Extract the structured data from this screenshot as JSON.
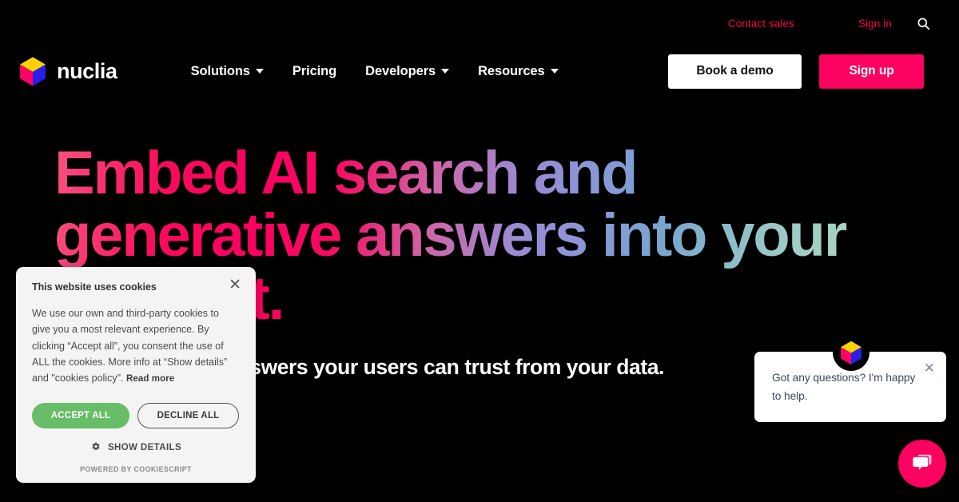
{
  "brand": {
    "name": "nuclia",
    "logo_icon": "nuclia-cube-logo",
    "accent_pink": "#fb0160",
    "cube_top": "#ffd300",
    "cube_left": "#ff0066",
    "cube_right": "#2b1ee8"
  },
  "utility": {
    "contact_sales": "Contact sales",
    "sign_in": "Sign in",
    "search_icon": "search-icon"
  },
  "nav": {
    "items": [
      {
        "label": "Solutions",
        "has_caret": true
      },
      {
        "label": "Pricing",
        "has_caret": false
      },
      {
        "label": "Developers",
        "has_caret": true
      },
      {
        "label": "Resources",
        "has_caret": true
      }
    ],
    "book_demo": "Book a demo",
    "sign_up": "Sign up"
  },
  "hero": {
    "title": "Embed AI search and generative answers into your product.",
    "subtitle": "Use Nuclia to get answers your users can trust from your data."
  },
  "cookie_banner": {
    "title": "This website uses cookies",
    "body": "We use our own and third-party cookies to give you a most relevant experience. By clicking “Accept all”, you consent the use of ALL the cookies. More info at “Show details” and \"cookies policy\". ",
    "read_more": "Read more",
    "accept_label": "ACCEPT ALL",
    "decline_label": "DECLINE ALL",
    "show_details_label": "SHOW DETAILS",
    "show_details_icon": "gear-icon",
    "powered_by": "POWERED BY COOKIESCRIPT",
    "close_icon": "close-icon",
    "accept_color": "#68bd68"
  },
  "chat": {
    "message": "Got any questions? I'm happy to help.",
    "close_icon": "close-icon",
    "avatar_icon": "nuclia-cube-logo",
    "fab_icon": "chat-bubble-icon",
    "fab_color": "#fb0160"
  }
}
